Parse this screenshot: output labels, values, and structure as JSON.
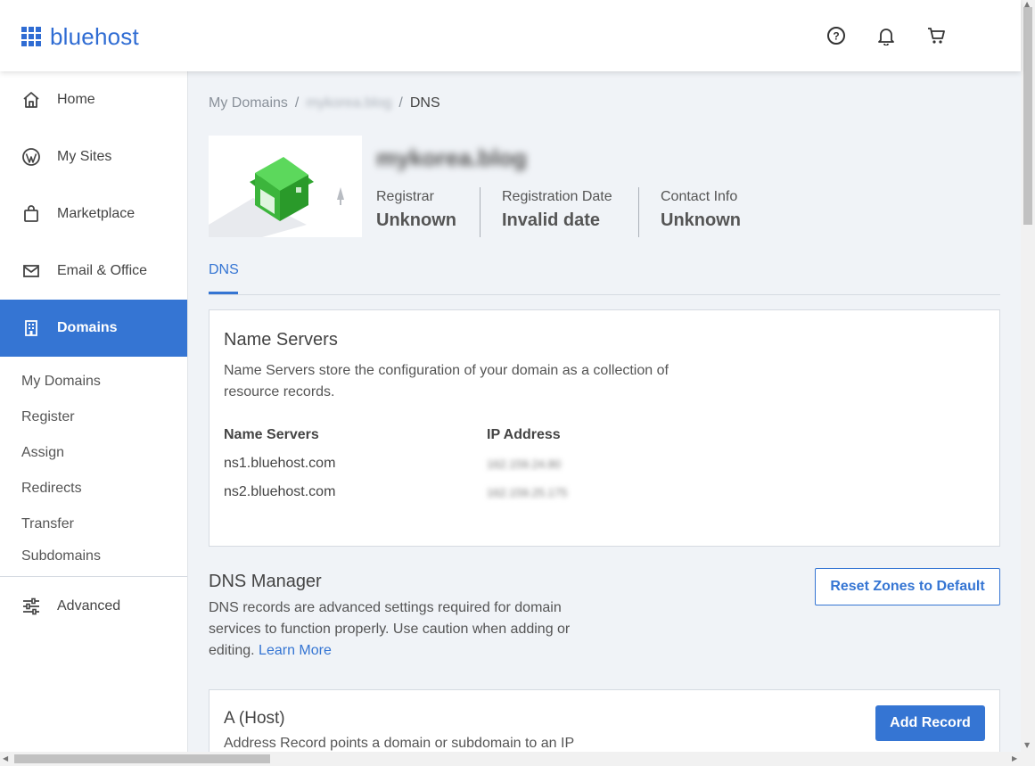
{
  "header": {
    "logo_text": "bluehost",
    "icons": [
      "help-circle-icon",
      "bell-icon",
      "cart-icon"
    ]
  },
  "sidebar": {
    "items": [
      {
        "label": "Home",
        "icon": "home-icon"
      },
      {
        "label": "My Sites",
        "icon": "wordpress-icon"
      },
      {
        "label": "Marketplace",
        "icon": "shopping-bag-icon"
      },
      {
        "label": "Email & Office",
        "icon": "envelope-icon"
      },
      {
        "label": "Domains",
        "icon": "building-icon"
      }
    ],
    "sub_items": [
      "My Domains",
      "Register",
      "Assign",
      "Redirects",
      "Transfer",
      "Subdomains"
    ],
    "advanced": {
      "label": "Advanced",
      "icon": "sliders-icon"
    }
  },
  "breadcrumb": {
    "root": "My Domains",
    "separator": "/",
    "domain": "mykorea.blog",
    "current": "DNS"
  },
  "domain": {
    "name": "mykorea.blog",
    "registrar_label": "Registrar",
    "registrar_value": "Unknown",
    "reg_date_label": "Registration Date",
    "reg_date_value": "Invalid date",
    "contact_label": "Contact Info",
    "contact_value": "Unknown"
  },
  "tabs": [
    {
      "label": "DNS",
      "active": true
    }
  ],
  "name_servers": {
    "title": "Name Servers",
    "description_line1": "Name Servers store the configuration of your domain as a collection of",
    "description_line2": "resource records.",
    "col_server": "Name Servers",
    "col_ip": "IP Address",
    "rows": [
      {
        "server": "ns1.bluehost.com",
        "ip": "162.159.24.80"
      },
      {
        "server": "ns2.bluehost.com",
        "ip": "162.159.25.175"
      }
    ]
  },
  "dns_manager": {
    "title": "DNS Manager",
    "description": "DNS records are advanced settings required for domain services to function properly. Use caution when adding or editing.",
    "learn_more": "Learn More",
    "reset_button": "Reset Zones to Default"
  },
  "a_host": {
    "title": "A (Host)",
    "description": "Address Record points a domain or subdomain to an IP",
    "add_button": "Add Record"
  },
  "colors": {
    "accent": "#3575d3",
    "logo_blue": "#2f6cd3",
    "house_green": "#3cb53c"
  }
}
